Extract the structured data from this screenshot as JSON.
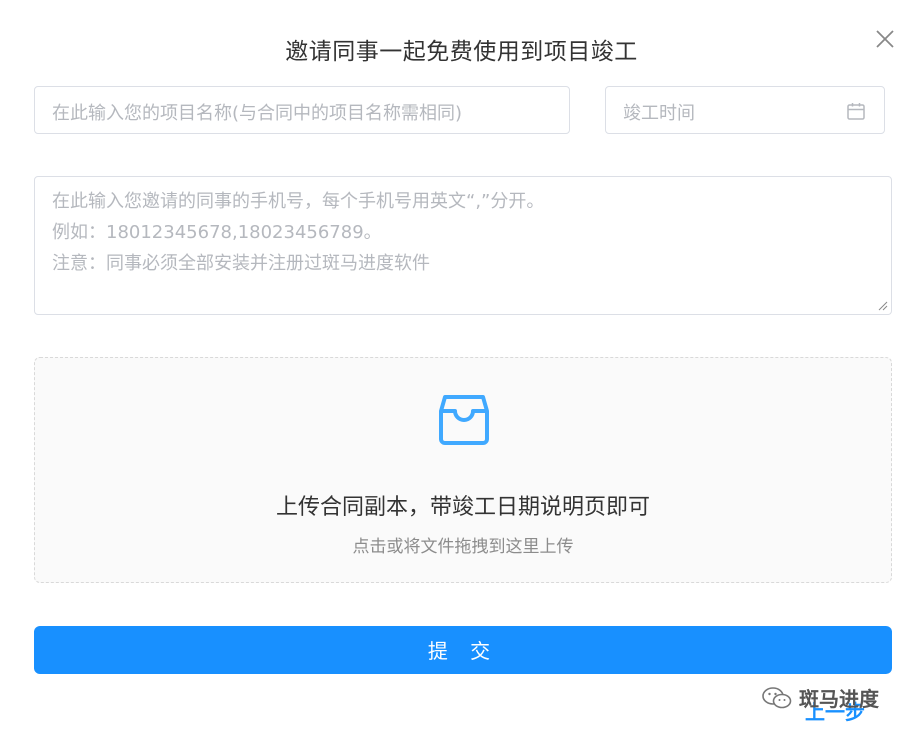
{
  "dialog": {
    "title": "邀请同事一起免费使用到项目竣工",
    "close_icon": "close-icon"
  },
  "form": {
    "project_name": {
      "placeholder": "在此输入您的项目名称(与合同中的项目名称需相同)",
      "value": ""
    },
    "completion_date": {
      "placeholder": "竣工时间",
      "icon": "calendar-icon",
      "value": ""
    },
    "phones": {
      "placeholder_lines": [
        "在此输入您邀请的同事的手机号，每个手机号用英文“,”分开。",
        "例如：18012345678,18023456789。",
        "注意：同事必须全部安装并注册过斑马进度软件"
      ],
      "value": ""
    }
  },
  "upload": {
    "icon": "inbox-icon",
    "text": "上传合同副本，带竣工日期说明页即可",
    "hint": "点击或将文件拖拽到这里上传"
  },
  "actions": {
    "submit_label": "提 交",
    "prev_label": "上一步"
  },
  "watermark": {
    "icon": "wechat-icon",
    "text": "斑马进度"
  },
  "colors": {
    "primary": "#1890ff",
    "border": "#dcdfe6",
    "placeholder": "#b5b8be",
    "upload_bg": "#fafafa"
  }
}
